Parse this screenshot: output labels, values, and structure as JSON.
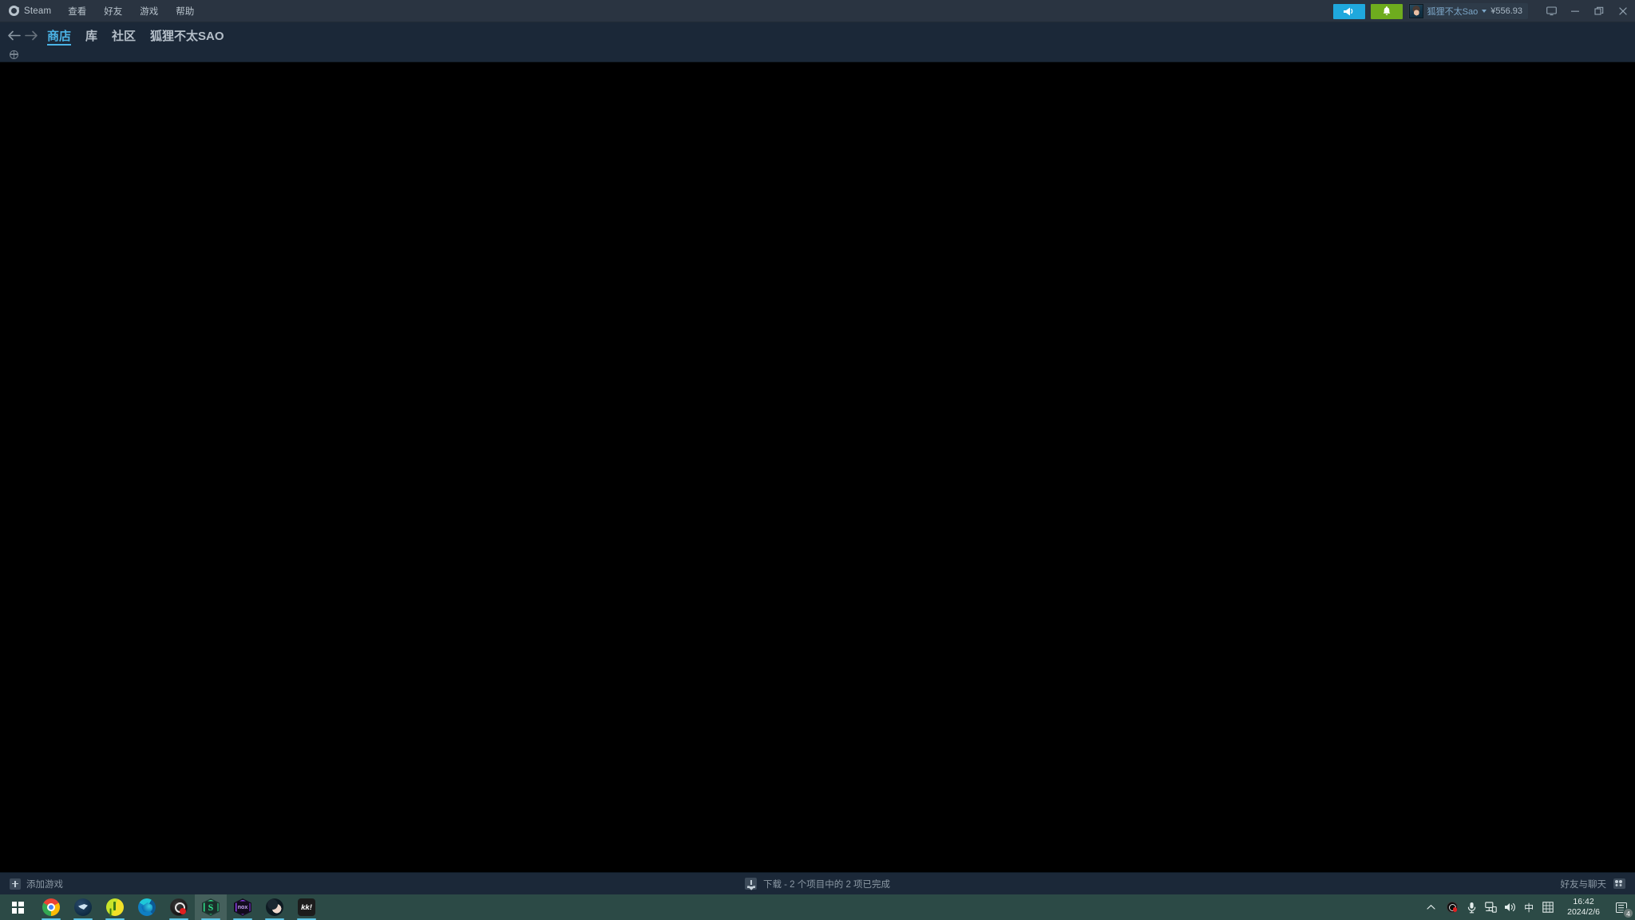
{
  "app": {
    "name": "Steam",
    "window_background": "#1b2838",
    "content_background": "#000000",
    "accent": "#4bb4e6"
  },
  "menu": {
    "logo_label": "Steam",
    "items": [
      {
        "label": "查看"
      },
      {
        "label": "好友"
      },
      {
        "label": "游戏"
      },
      {
        "label": "帮助"
      }
    ]
  },
  "titlebar_right": {
    "broadcast_icon": "megaphone-icon",
    "broadcast_color": "#1fa8dd",
    "notification_icon": "bell-icon",
    "notification_color": "#6eac1e",
    "account_name": "狐狸不太Sao",
    "account_balance": "¥556.93",
    "window_controls": [
      {
        "name": "display-mode-button",
        "icon": "monitor-icon"
      },
      {
        "name": "minimize-button",
        "icon": "minimize-icon"
      },
      {
        "name": "maximize-button",
        "icon": "restore-icon"
      },
      {
        "name": "close-button",
        "icon": "close-icon"
      }
    ]
  },
  "nav": {
    "back_icon": "arrow-left-icon",
    "forward_icon": "arrow-right-icon",
    "tabs": [
      {
        "label": "商店",
        "active": true
      },
      {
        "label": "库",
        "active": false
      },
      {
        "label": "社区",
        "active": false
      },
      {
        "label": "狐狸不太SAO",
        "active": false
      }
    ]
  },
  "subbar": {
    "icon": "globe-icon"
  },
  "statusbar": {
    "add_game_label": "添加游戏",
    "add_game_icon": "plus-icon",
    "download_icon": "download-icon",
    "download_label": "下载 - 2 个项目中的 2 项已完成",
    "friends_label": "好友与聊天",
    "friends_icon": "friends-icon"
  },
  "taskbar": {
    "background": "#2c4a46",
    "start_icon": "windows-start-icon",
    "apps": [
      {
        "name": "chrome",
        "icon_class": "ic-chrome",
        "running": true,
        "active": false
      },
      {
        "name": "steam",
        "icon_class": "ic-steam",
        "running": true,
        "active": false
      },
      {
        "name": "music-player",
        "icon_class": "ic-music",
        "running": true,
        "active": false
      },
      {
        "name": "edge",
        "icon_class": "ic-edge",
        "running": false,
        "active": false
      },
      {
        "name": "obs-studio",
        "icon_class": "ic-obs",
        "running": true,
        "active": false
      },
      {
        "name": "snipaste",
        "icon_class": "ic-hex",
        "running": true,
        "active": true
      },
      {
        "name": "nox-player",
        "icon_class": "ic-nox",
        "running": true,
        "active": false
      },
      {
        "name": "avatar-app",
        "icon_class": "ic-person",
        "running": true,
        "active": false
      },
      {
        "name": "kk-app",
        "icon_class": "ic-kk",
        "running": true,
        "active": false
      }
    ],
    "tray": {
      "chevron_icon": "chevron-up-icon",
      "icons": [
        {
          "name": "obs-tray-icon"
        },
        {
          "name": "microphone-icon"
        },
        {
          "name": "network-icon"
        },
        {
          "name": "volume-icon"
        },
        {
          "name": "ime-icon",
          "label": "中"
        },
        {
          "name": "input-panel-icon"
        }
      ],
      "clock_time": "16:42",
      "clock_date": "2024/2/6",
      "notification_count": "4"
    }
  }
}
